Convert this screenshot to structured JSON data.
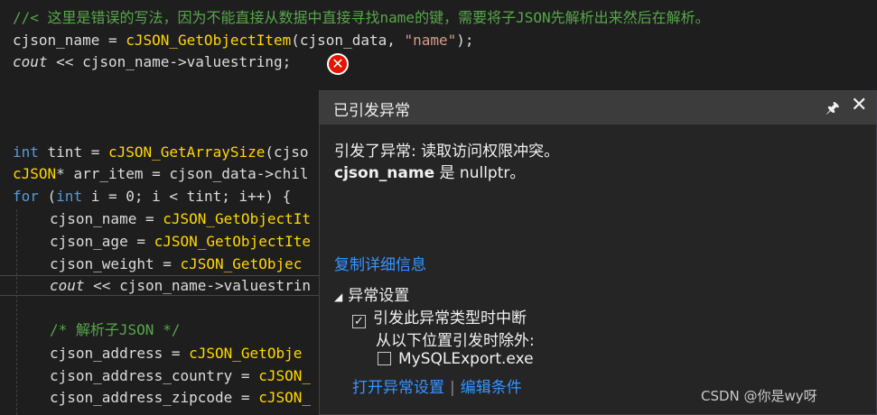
{
  "code": {
    "l1": "//< 这里是错误的写法，因为不能直接从数据中直接寻找name的键，需要将子JSON先解析出来然后在解析。",
    "l2": {
      "a": "cjson_name = ",
      "fn": "cJSON_GetObjectItem",
      "b": "(cjson_data, ",
      "s": "\"name\"",
      "c": ");"
    },
    "l3": {
      "a": "cout",
      "b": " << cjson_name->valuestring;"
    },
    "l4": {
      "kw": "int",
      "a": " tint = ",
      "fn": "cJSON_GetArraySize",
      "b": "(cjso"
    },
    "l5": {
      "ty": "cJSON",
      "a": "* arr_item = cjson_data->chil"
    },
    "l6": {
      "kw1": "for",
      "a": " (",
      "kw2": "int",
      "b": " i = 0; i < tint; i++) {"
    },
    "l7": {
      "a": "cjson_name = ",
      "fn": "cJSON_GetObjectIt"
    },
    "l8": {
      "a": "cjson_age = ",
      "fn": "cJSON_GetObjectIte"
    },
    "l9": {
      "a": "cjson_weight = ",
      "fn": "cJSON_GetObjec"
    },
    "l10": {
      "a": "cout",
      "b": " << cjson_name->valuestrin"
    },
    "l11": "/* 解析子JSON */",
    "l12": {
      "a": "cjson_address = ",
      "fn": "cJSON_GetObje"
    },
    "l13": {
      "a": "cjson_address_country = ",
      "fn": "cJSON_"
    },
    "l14": {
      "a": "cjson_address_zipcode = ",
      "fn": "cJSON_"
    }
  },
  "error_icon": "close-circle-icon",
  "popup": {
    "title": "已引发异常",
    "pin_glyph": "🖈",
    "close_glyph": "✕",
    "message_line1": "引发了异常: 读取访问权限冲突。",
    "message_var": "cjson_name",
    "message_rest": " 是 nullptr。",
    "copy_details": "复制详细信息",
    "settings_title": "异常设置",
    "break_when_thrown": "引发此异常类型时中断",
    "break_checked": true,
    "except_when_from": "从以下位置引发时除外:",
    "module_name": "MySQLExport.exe",
    "module_checked": false,
    "open_settings": "打开异常设置",
    "edit_conditions": "编辑条件"
  },
  "colors": {
    "editor_bg": "#1e1e1e",
    "comment": "#57a64a",
    "keyword": "#569cd6",
    "function": "#ffd700",
    "string": "#d69d85",
    "link": "#3794ff",
    "error_red": "#e51400"
  },
  "watermark": "CSDN @你是wy呀"
}
